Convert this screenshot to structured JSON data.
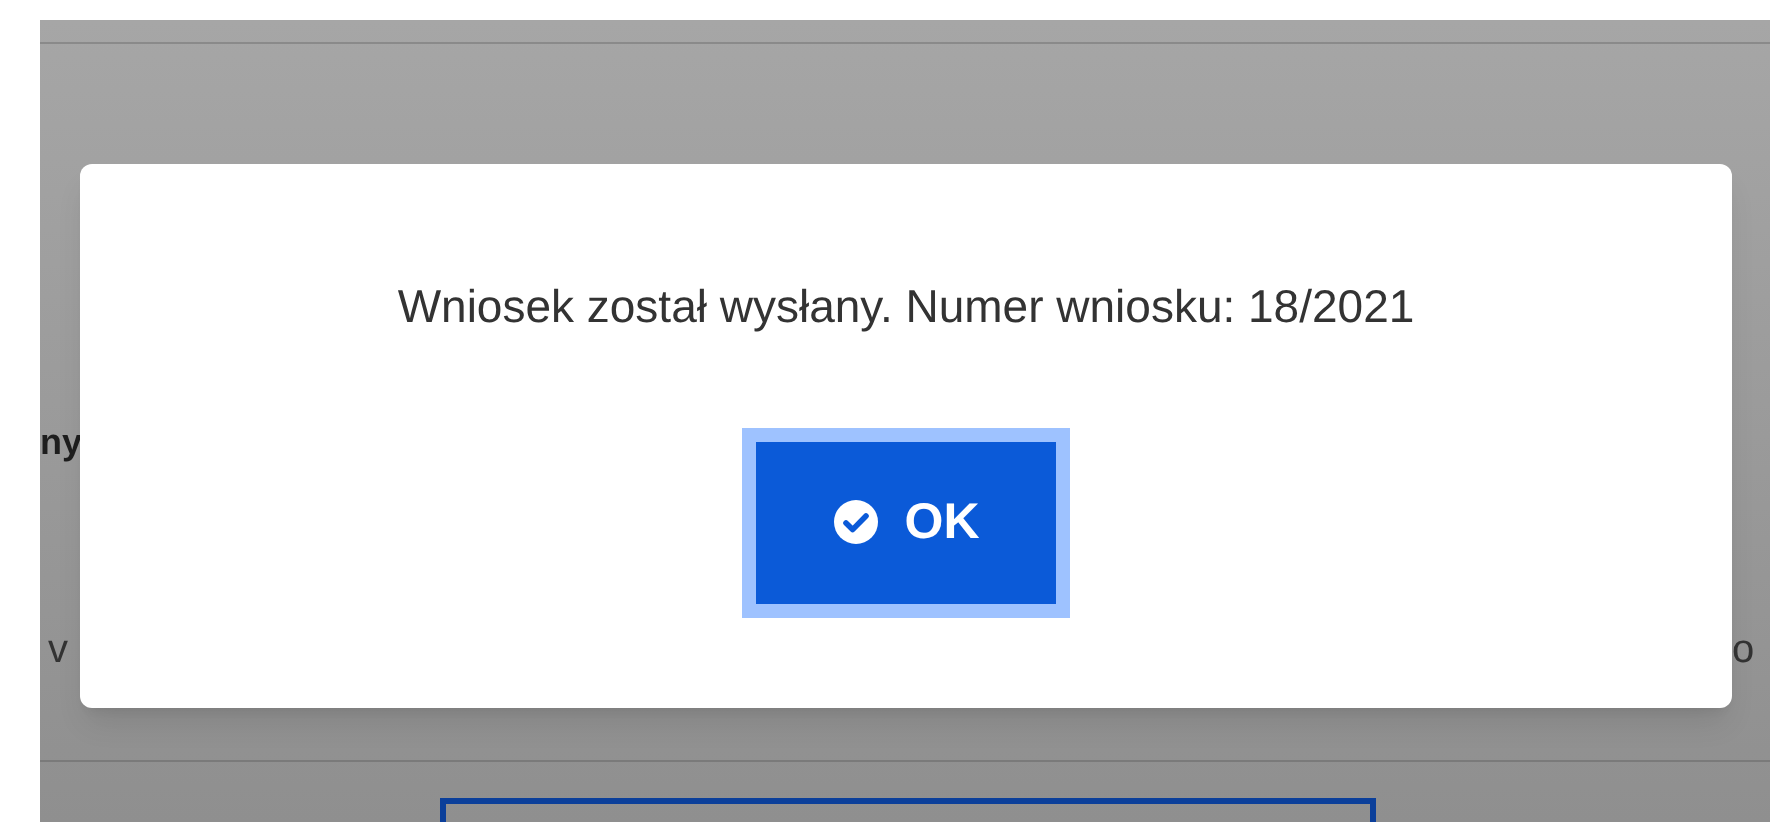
{
  "background": {
    "texts": [
      {
        "text": "ny",
        "kind": "heading"
      },
      {
        "text": "v",
        "kind": "left"
      },
      {
        "text": "o",
        "kind": "right"
      }
    ]
  },
  "dialog": {
    "message": "Wniosek został wysłany. Numer wniosku: 18/2021",
    "button": {
      "label": "OK",
      "focused": true
    }
  }
}
